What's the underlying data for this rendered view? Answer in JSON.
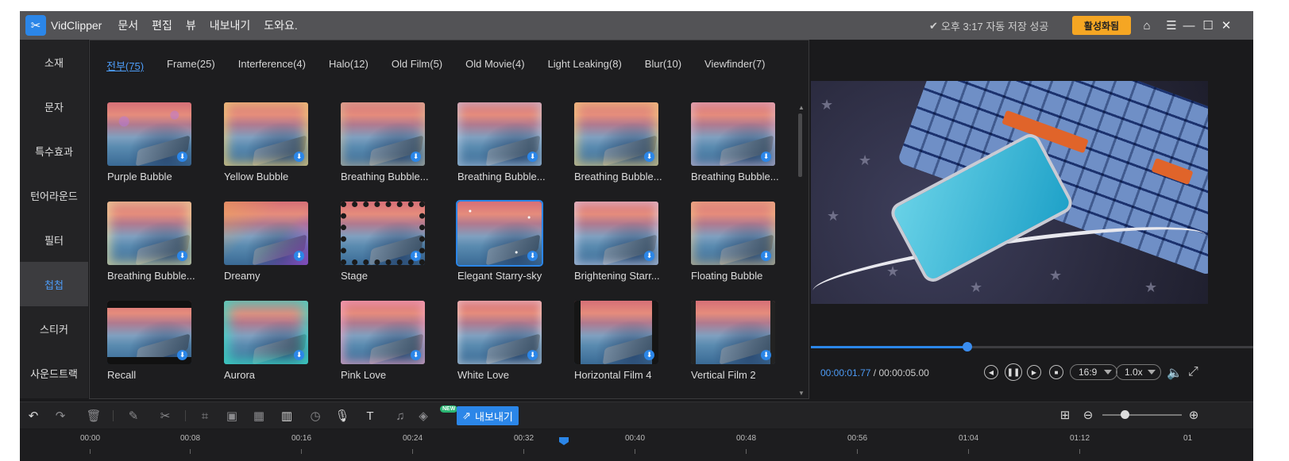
{
  "app": {
    "name": "VidClipper",
    "menu": [
      "문서",
      "편집",
      "뷰",
      "내보내기",
      "도와요."
    ],
    "save_status": "오후 3:17 자동 저장 성공",
    "activate_label": "활성화됨",
    "accent_color": "#2b86e8",
    "activate_color": "#f5a623"
  },
  "sidebar": {
    "items": [
      {
        "label": "소재"
      },
      {
        "label": "문자"
      },
      {
        "label": "특수효과"
      },
      {
        "label": "턴어라운드"
      },
      {
        "label": "필터"
      },
      {
        "label": "첩첩"
      },
      {
        "label": "스티커"
      },
      {
        "label": "사운드트랙"
      }
    ],
    "active_index": 5
  },
  "library": {
    "tabs": [
      {
        "label": "전부(75)"
      },
      {
        "label": "Frame(25)"
      },
      {
        "label": "Interference(4)"
      },
      {
        "label": "Halo(12)"
      },
      {
        "label": "Old Film(5)"
      },
      {
        "label": "Old Movie(4)"
      },
      {
        "label": "Light Leaking(8)"
      },
      {
        "label": "Blur(10)"
      },
      {
        "label": "Viewfinder(7)"
      }
    ],
    "active_tab": 0,
    "items": [
      {
        "label": "Purple Bubble"
      },
      {
        "label": "Yellow Bubble"
      },
      {
        "label": "Breathing Bubble..."
      },
      {
        "label": "Breathing Bubble..."
      },
      {
        "label": "Breathing Bubble..."
      },
      {
        "label": "Breathing Bubble..."
      },
      {
        "label": "Breathing Bubble..."
      },
      {
        "label": "Dreamy"
      },
      {
        "label": "Stage"
      },
      {
        "label": "Elegant Starry-sky"
      },
      {
        "label": "Brightening Starr..."
      },
      {
        "label": "Floating Bubble"
      },
      {
        "label": "Recall"
      },
      {
        "label": "Aurora"
      },
      {
        "label": "Pink Love"
      },
      {
        "label": "White Love"
      },
      {
        "label": "Horizontal Film 4"
      },
      {
        "label": "Vertical Film 2"
      }
    ],
    "selected_index": 9,
    "download_icon": "download-icon"
  },
  "preview": {
    "current_time": "00:00:01.77",
    "separator": "/",
    "total_time": "00:00:05.00",
    "progress": 0.354,
    "aspect_ratio": "16:9",
    "speed": "1.0x"
  },
  "toolbar": {
    "new_badge": "NEW",
    "export_label": "내보내기",
    "zoom_level": 0.28
  },
  "timeline": {
    "ticks": [
      "00:00",
      "00:08",
      "00:16",
      "00:24",
      "00:32",
      "00:40",
      "00:48",
      "00:56",
      "01:04",
      "01:12",
      "01"
    ]
  }
}
